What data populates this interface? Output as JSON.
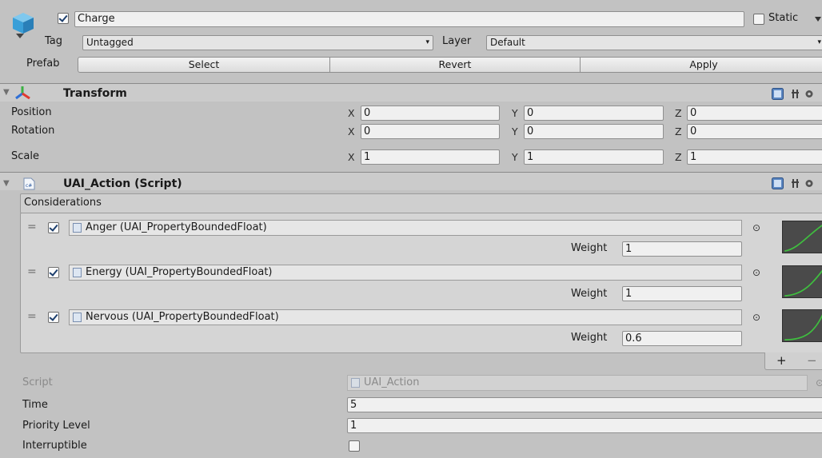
{
  "gameobject": {
    "active": true,
    "name": "Charge",
    "static_label": "Static",
    "tag_label": "Tag",
    "tag_value": "Untagged",
    "layer_label": "Layer",
    "layer_value": "Default",
    "prefab_label": "Prefab",
    "prefab_buttons": [
      "Select",
      "Revert",
      "Apply"
    ]
  },
  "transform": {
    "title": "Transform",
    "rows": [
      {
        "label": "Position",
        "x": "0",
        "y": "0",
        "z": "0"
      },
      {
        "label": "Rotation",
        "x": "0",
        "y": "0",
        "z": "0"
      },
      {
        "label": "Scale",
        "x": "1",
        "y": "1",
        "z": "1"
      }
    ],
    "axis_labels": [
      "X",
      "Y",
      "Z"
    ]
  },
  "script_component": {
    "title": "UAI_Action (Script)",
    "considerations_label": "Considerations",
    "weight_label": "Weight",
    "considerations": [
      {
        "enabled": true,
        "name": "Anger (UAI_PropertyBoundedFloat)",
        "weight": "1"
      },
      {
        "enabled": true,
        "name": "Energy (UAI_PropertyBoundedFloat)",
        "weight": "1"
      },
      {
        "enabled": true,
        "name": "Nervous (UAI_PropertyBoundedFloat)",
        "weight": "0.6"
      }
    ],
    "add_label": "+",
    "remove_label": "−",
    "script_label": "Script",
    "script_value": "UAI_Action",
    "time_label": "Time",
    "time_value": "5",
    "priority_label": "Priority Level",
    "priority_value": "1",
    "interruptible_label": "Interruptible",
    "interruptible_value": false
  },
  "icons": {
    "gameobject": "cube-icon",
    "transform": "axes-icon",
    "script": "csharp-script-icon",
    "help": "help-icon",
    "settings": "settings-icon",
    "object_field": "scriptable-object-icon"
  },
  "colors": {
    "background": "#c2c2c2",
    "field": "#f0f0f0",
    "curve_bg": "#4a4a4a",
    "curve_line": "#3fbf3f"
  }
}
